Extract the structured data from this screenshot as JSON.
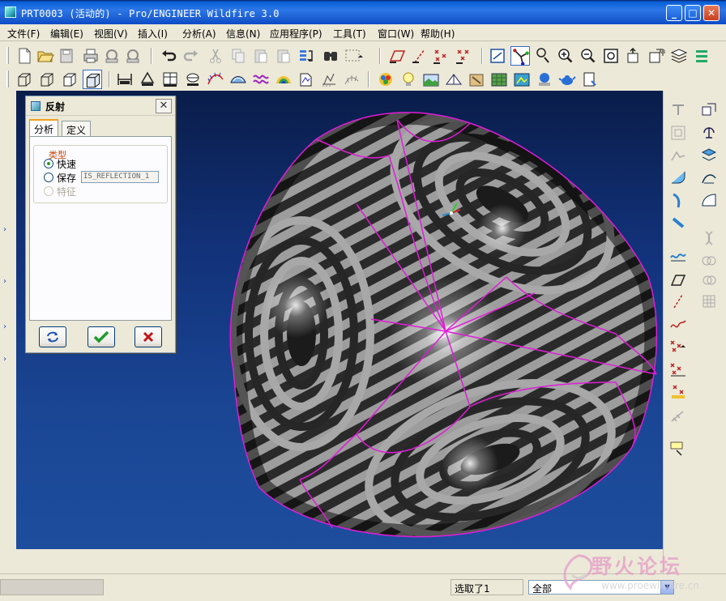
{
  "window": {
    "title": "PRT0003 (活动的) - Pro/ENGINEER Wildfire 3.0",
    "minimize_label": "_",
    "maximize_label": "□",
    "close_label": "✕"
  },
  "menu": [
    {
      "label": "文件(F)"
    },
    {
      "label": "编辑(E)"
    },
    {
      "label": "视图(V)"
    },
    {
      "label": "插入(I)"
    },
    {
      "label": "分析(A)"
    },
    {
      "label": "信息(N)"
    },
    {
      "label": "应用程序(P)"
    },
    {
      "label": "工具(T)"
    },
    {
      "label": "窗口(W)"
    },
    {
      "label": "帮助(H)"
    }
  ],
  "toolbar_top": [
    "new-file-icon",
    "open-folder-icon",
    "save-icon",
    "print-icon",
    "send-email-icon",
    "email-attach-icon",
    "undo-icon",
    "redo-icon",
    "cut-icon",
    "copy-icon",
    "paste-icon",
    "paste-special-icon",
    "regenerate-icon",
    "find-icon",
    "selection-box-icon",
    "datum-plane-display-icon",
    "datum-axis-display-icon",
    "datum-point-display-icon",
    "coordinate-system-display-icon",
    "refit-icon",
    "zoom-in-icon",
    "zoom-out-icon",
    "reorient-icon",
    "spin-center-icon",
    "saved-views-icon",
    "layers-icon"
  ],
  "toolbar_bottom": [
    "wireframe-icon",
    "hidden-line-icon",
    "no-hidden-icon",
    "shading-icon",
    "measure-distance-icon",
    "measure-area-icon",
    "mass-properties-icon",
    "section-icon",
    "curvature-icon",
    "draft-analysis-icon",
    "reflection-icon",
    "shaded-curvature-icon",
    "slope-icon",
    "dihedral-icon",
    "offset-analysis-icon",
    "deviation-icon",
    "thickness-icon",
    "color-picker-icon",
    "light-bulb-icon",
    "scene-icon",
    "perspective-icon",
    "appearance-icon",
    "texture-map-icon",
    "model-player-icon",
    "render-icon",
    "teapot-icon",
    "export-icon"
  ],
  "right_toolbar": [
    "datum-plane-tool-icon",
    "datum-axis-tool-icon",
    "datum-curve-tool-icon",
    "datum-point-tool-icon",
    "sketch-tool-icon",
    "offset-plane-icon",
    "round-tool-icon",
    "blend-tool-icon",
    "mirror-tool-icon",
    "pattern-tool-icon",
    "extend-tool-icon",
    "merge-tool-icon",
    "trim-tool-icon",
    "intersect-tool-icon",
    "project-tool-icon",
    "wrap-tool-icon",
    "plane-tool-icon",
    "offset-tool-icon",
    "thicken-tool-icon",
    "solidify-tool-icon",
    "sketch-curve-icon",
    "style-tool-icon",
    "datum-point-add-icon",
    "offset-point-icon",
    "field-point-icon",
    "dimension-annotation-icon",
    "note-tool-icon"
  ],
  "dialog": {
    "title": "反射",
    "close_label": "✕",
    "tabs": [
      {
        "label": "分析",
        "active": true
      },
      {
        "label": "定义",
        "active": false
      }
    ],
    "group_label": "类型",
    "options": [
      {
        "label": "快速",
        "checked": true,
        "enabled": true
      },
      {
        "label": "保存",
        "checked": false,
        "enabled": true,
        "field_value": "IS_REFLECTION_1"
      },
      {
        "label": "特征",
        "checked": false,
        "enabled": false
      }
    ],
    "buttons": [
      "repeat-icon",
      "ok-check-icon",
      "cancel-x-icon"
    ]
  },
  "status": {
    "message": "选取了1",
    "filter_value": "全部"
  },
  "watermark": {
    "title": "野火论坛",
    "url": "www.proewildfire.cn"
  },
  "colors": {
    "title_bar": "#1f63d6",
    "viewport_top": "#0a1d4a",
    "viewport_bottom": "#1e4d9e",
    "surface_dark": "#2b2b2b",
    "surface_light": "#b9b9b9",
    "edge_curve": "#e01cd8"
  }
}
